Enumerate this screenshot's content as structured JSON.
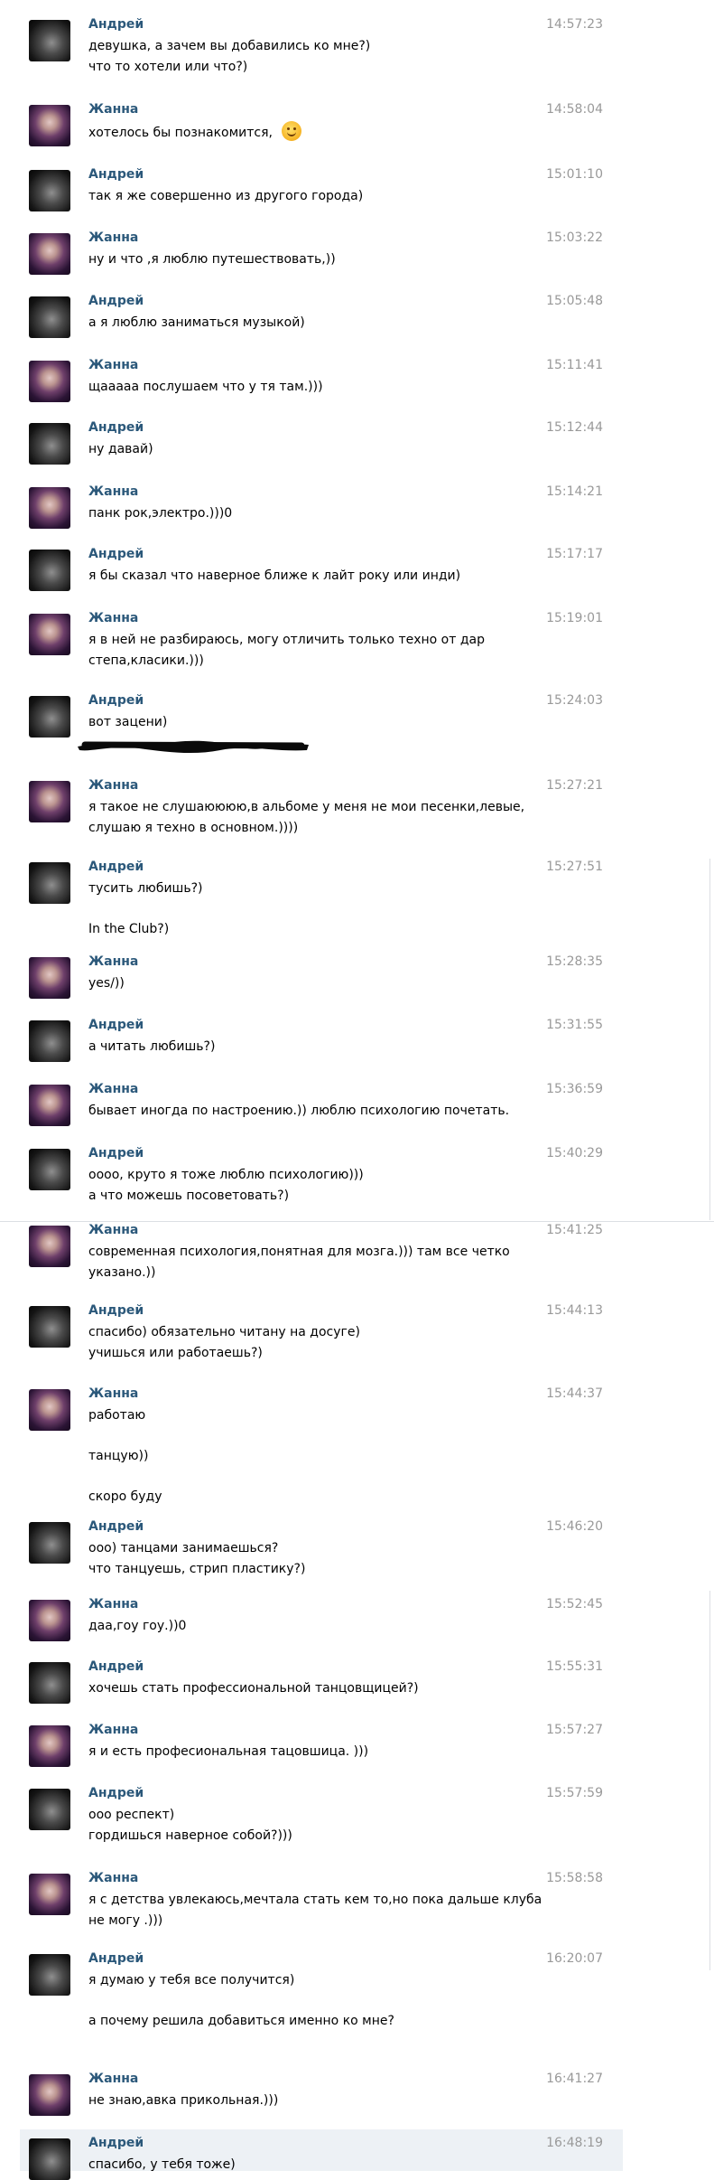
{
  "messages": [
    {
      "author": "Андрей",
      "avatar": "andrey",
      "time": "14:57:23",
      "lines": [
        "девушка, а зачем вы добавились ко мне?)",
        "что то хотели или что?)"
      ]
    },
    {
      "author": "Жанна",
      "avatar": "zhanna",
      "time": "14:58:04",
      "lines": [
        "хотелось бы познакомится, "
      ],
      "emoji": "smile-emoji"
    },
    {
      "author": "Андрей",
      "avatar": "andrey",
      "time": "15:01:10",
      "lines": [
        "так я же совершенно из другого города)"
      ]
    },
    {
      "author": "Жанна",
      "avatar": "zhanna",
      "time": "15:03:22",
      "lines": [
        "ну и что ,я люблю путешествовать,))"
      ]
    },
    {
      "author": "Андрей",
      "avatar": "andrey",
      "time": "15:05:48",
      "lines": [
        "а я люблю заниматься музыкой)"
      ]
    },
    {
      "author": "Жанна",
      "avatar": "zhanna",
      "time": "15:11:41",
      "lines": [
        "щааааа послушаем что у тя там.)))"
      ]
    },
    {
      "author": "Андрей",
      "avatar": "andrey",
      "time": "15:12:44",
      "lines": [
        "ну давай)"
      ]
    },
    {
      "author": "Жанна",
      "avatar": "zhanna",
      "time": "15:14:21",
      "lines": [
        "панк рок,электро.)))0"
      ]
    },
    {
      "author": "Андрей",
      "avatar": "andrey",
      "time": "15:17:17",
      "lines": [
        "я бы сказал что наверное ближе к лайт року или инди)"
      ]
    },
    {
      "author": "Жанна",
      "avatar": "zhanna",
      "time": "15:19:01",
      "lines": [
        "я в ней не разбираюсь, могу отличить только техно от дар",
        "степа,класики.)))"
      ]
    },
    {
      "author": "Андрей",
      "avatar": "andrey",
      "time": "15:24:03",
      "lines": [
        "вот зацени)"
      ],
      "redacted": true
    },
    {
      "author": "Жанна",
      "avatar": "zhanna",
      "time": "15:27:21",
      "lines": [
        "я такое не слушаюююю,в альбоме у меня не мои песенки,левые,",
        "слушаю я техно в основном.))))"
      ]
    },
    {
      "author": "Андрей",
      "avatar": "andrey",
      "time": "15:27:51",
      "lines": [
        "тусить любишь?)",
        "+In the Club?)"
      ]
    },
    {
      "author": "Жанна",
      "avatar": "zhanna",
      "time": "15:28:35",
      "lines": [
        "yes/))"
      ]
    },
    {
      "author": "Андрей",
      "avatar": "andrey",
      "time": "15:31:55",
      "lines": [
        "а читать любишь?)"
      ]
    },
    {
      "author": "Жанна",
      "avatar": "zhanna",
      "time": "15:36:59",
      "lines": [
        "бывает иногда по настроению.)) люблю психологию почетать."
      ]
    },
    {
      "author": "Андрей",
      "avatar": "andrey",
      "time": "15:40:29",
      "lines": [
        "оооо, круто я тоже люблю психологию)))",
        "а что можешь посоветовать?)"
      ]
    },
    {
      "author": "Жанна",
      "avatar": "zhanna",
      "time": "15:41:25",
      "lines": [
        "современная психология,понятная для мозга.))) там все четко",
        "указано.))"
      ]
    },
    {
      "author": "Андрей",
      "avatar": "andrey",
      "time": "15:44:13",
      "lines": [
        "спасибо) обязательно читану на досуге)",
        "учишься или работаешь?)"
      ]
    },
    {
      "author": "Жанна",
      "avatar": "zhanna",
      "time": "15:44:37",
      "lines": [
        "работаю",
        "+танцую))",
        "+скоро буду"
      ]
    },
    {
      "author": "Андрей",
      "avatar": "andrey",
      "time": "15:46:20",
      "lines": [
        "ооо) танцами занимаешься?",
        "что танцуешь, стрип пластику?)"
      ]
    },
    {
      "author": "Жанна",
      "avatar": "zhanna",
      "time": "15:52:45",
      "lines": [
        "даа,гоу гоу.))0"
      ]
    },
    {
      "author": "Андрей",
      "avatar": "andrey",
      "time": "15:55:31",
      "lines": [
        "хочешь стать профессиональной танцовщицей?)"
      ]
    },
    {
      "author": "Жанна",
      "avatar": "zhanna",
      "time": "15:57:27",
      "lines": [
        "я и есть професиональная тацовшица. )))"
      ]
    },
    {
      "author": "Андрей",
      "avatar": "andrey",
      "time": "15:57:59",
      "lines": [
        "ооо респект)",
        "гордишься наверное собой?)))"
      ]
    },
    {
      "author": "Жанна",
      "avatar": "zhanna",
      "time": "15:58:58",
      "lines": [
        "я с детства увлекаюсь,мечтала стать кем то,но пока дальше клуба",
        "не могу .)))"
      ]
    },
    {
      "author": "Андрей",
      "avatar": "andrey",
      "time": "16:20:07",
      "lines": [
        "я думаю у тебя все получится)",
        "+а почему решила добавиться именно ко мне?"
      ]
    },
    {
      "author": "Жанна",
      "avatar": "zhanna",
      "time": "16:41:27",
      "lines": [
        "не знаю,авка прикольная.)))"
      ]
    },
    {
      "author": "Андрей",
      "avatar": "andrey",
      "time": "16:48:19",
      "lines": [
        "спасибо, у тебя тоже)"
      ],
      "highlighted": true
    }
  ]
}
